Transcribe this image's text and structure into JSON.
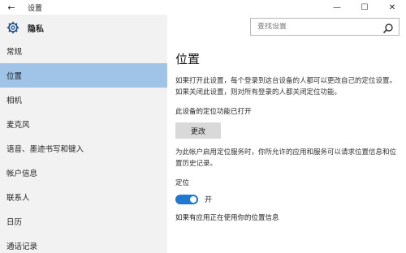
{
  "window": {
    "title": "设置",
    "back_glyph": "←",
    "minimize_glyph": "—",
    "maximize_glyph": "☐",
    "close_glyph": "✕"
  },
  "sidebar": {
    "section_title": "隐私",
    "section_icon": "gear-icon",
    "items": [
      {
        "label": "常规",
        "active": false
      },
      {
        "label": "位置",
        "active": true
      },
      {
        "label": "相机",
        "active": false
      },
      {
        "label": "麦克风",
        "active": false
      },
      {
        "label": "语音、墨迹书写和键入",
        "active": false
      },
      {
        "label": "帐户信息",
        "active": false
      },
      {
        "label": "联系人",
        "active": false
      },
      {
        "label": "日历",
        "active": false
      },
      {
        "label": "通话记录",
        "active": false
      }
    ],
    "active_color": "#9fc4e8"
  },
  "search": {
    "placeholder": "查找设置",
    "icon": "search-icon"
  },
  "main": {
    "title": "位置",
    "intro": "如果打开此设置，每个登录到这台设备的人都可以更改自己的定位设置。如果关闭此设置，则对所有登录的人都关闭定位功能。",
    "device_status": "此设备的定位功能已打开",
    "change_button": "更改",
    "account_desc": "为此帐户启用定位服务时，你所允许的应用和服务可以请求位置信息和位置历史记录。",
    "location_label": "定位",
    "toggle_state": "开",
    "toggle_on": true,
    "toggle_color": "#1f78d1",
    "apps_using": "如果有应用正在使用你的位置信息"
  }
}
